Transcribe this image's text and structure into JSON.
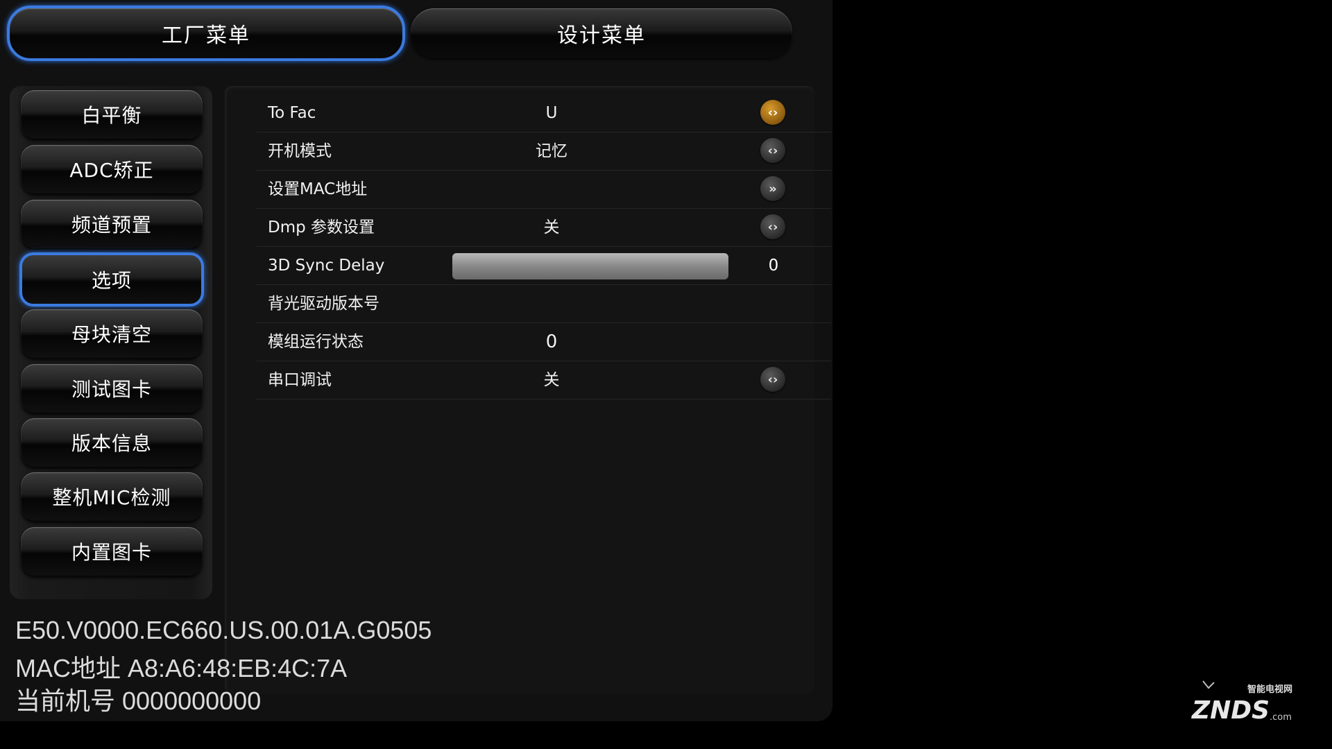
{
  "tabs": {
    "factory": "工厂菜单",
    "design": "设计菜单"
  },
  "sidebar": {
    "items": [
      {
        "label": "白平衡"
      },
      {
        "label": "ADC矫正"
      },
      {
        "label": "频道预置"
      },
      {
        "label": "选项",
        "active": true
      },
      {
        "label": "母块清空"
      },
      {
        "label": "测试图卡"
      },
      {
        "label": "版本信息"
      },
      {
        "label": "整机MIC检测"
      },
      {
        "label": "内置图卡"
      }
    ]
  },
  "options": {
    "rows": [
      {
        "label": "To Fac",
        "value": "U"
      },
      {
        "label": "开机模式",
        "value": "记忆"
      },
      {
        "label": "设置MAC地址",
        "value": ""
      },
      {
        "label": "Dmp 参数设置",
        "value": "关"
      },
      {
        "label": "3D Sync Delay",
        "value": "0",
        "slider_fraction": 1.0
      },
      {
        "label": "背光驱动版本号",
        "value": ""
      },
      {
        "label": "模组运行状态",
        "value": "0"
      },
      {
        "label": "串口调试",
        "value": "关"
      }
    ]
  },
  "info": {
    "version": "E50.V0000.EC660.US.00.01A.G0505",
    "mac": "MAC地址  A8:A6:48:EB:4C:7A",
    "machine_no": "当前机号 0000000000"
  },
  "logo": {
    "top_text": "智能电视网",
    "brand": "ZNDS",
    "suffix": ".com"
  },
  "colors": {
    "accent_blue": "#3b7be0",
    "focus_orange": "#d89a2a"
  }
}
